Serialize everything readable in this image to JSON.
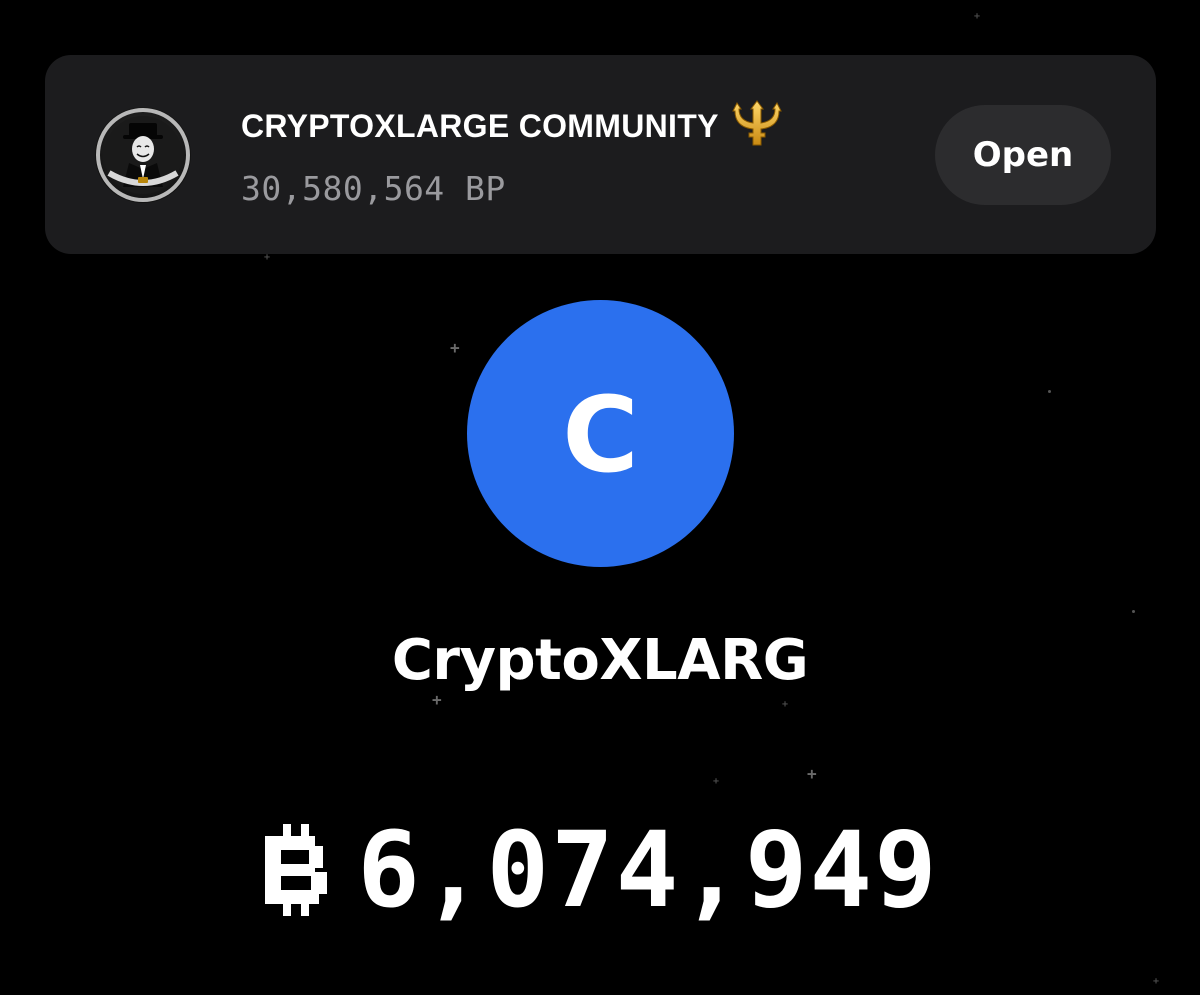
{
  "community": {
    "name": "CRYPTOXLARGE COMMUNITY",
    "emoji_icon": "trident-emoji",
    "points": "30,580,564 BP",
    "open_label": "Open",
    "avatar_icon": "anonymous-mask-avatar"
  },
  "profile": {
    "initial": "C",
    "name": "CryptoXLARG",
    "avatar_color": "#2b70ee"
  },
  "balance": {
    "currency_icon": "bp-coin-icon",
    "value": "6,074,949"
  },
  "theme": {
    "background": "#000000",
    "card": "#1c1c1e",
    "button": "#2c2c2e",
    "muted_text": "#9a9a9e"
  }
}
